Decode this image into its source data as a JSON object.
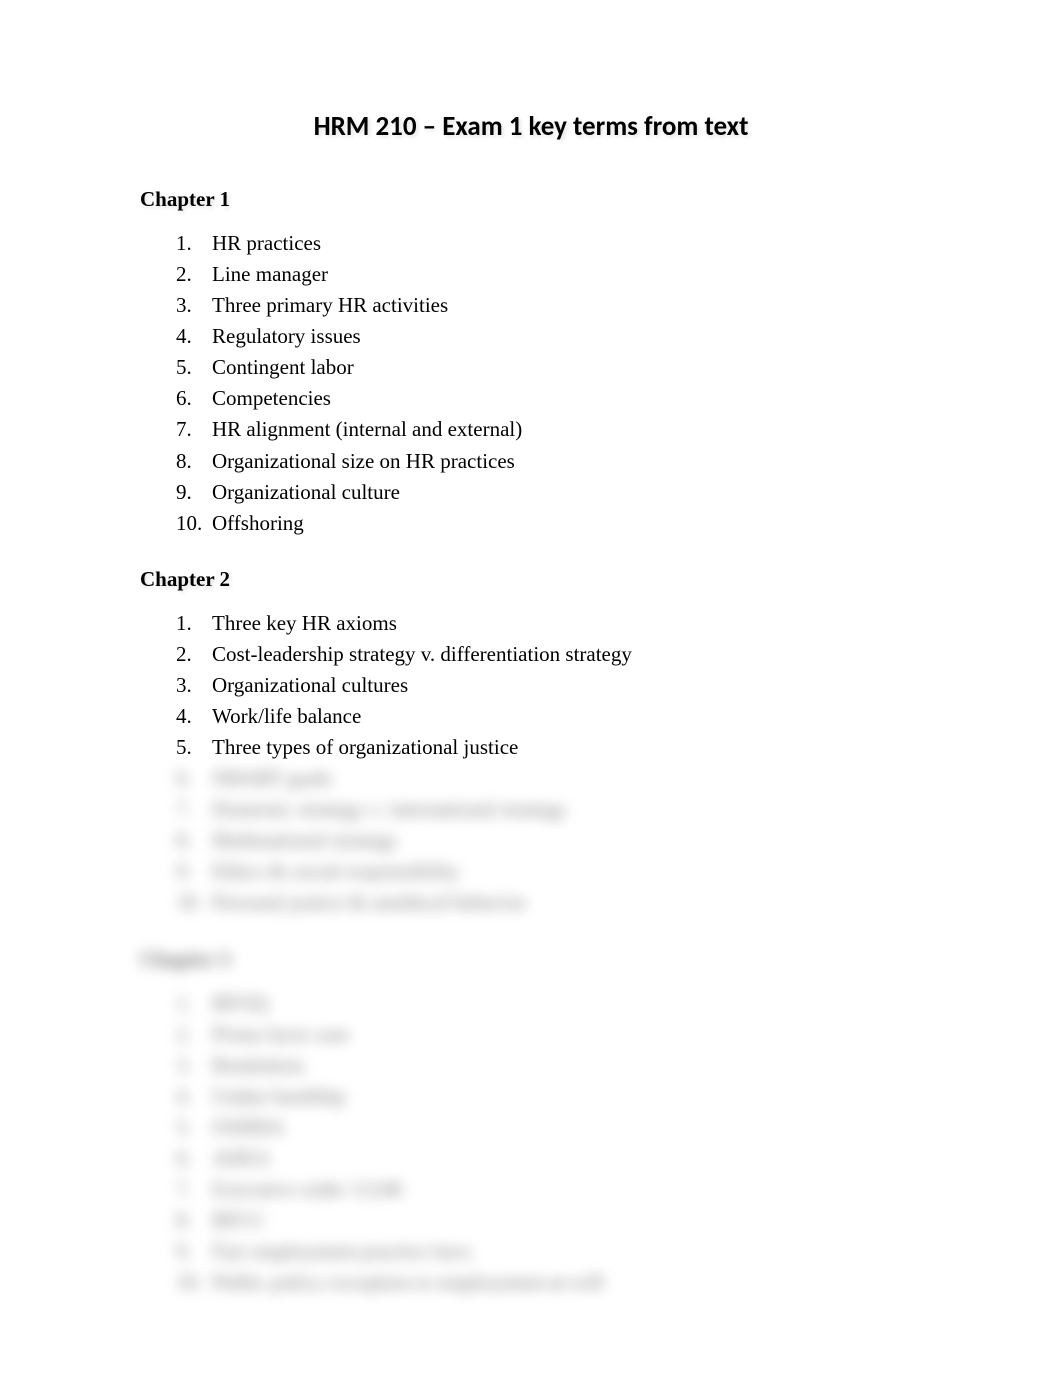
{
  "title": "HRM 210 – Exam 1 key terms from text",
  "chapters": [
    {
      "heading": "Chapter 1",
      "items": [
        "HR practices",
        "Line manager",
        "Three primary HR activities",
        "Regulatory issues",
        "Contingent labor",
        "Competencies",
        "HR alignment (internal and external)",
        "Organizational size on HR practices",
        "Organizational culture",
        "Offshoring"
      ]
    },
    {
      "heading": "Chapter 2",
      "items_visible": [
        "Three key HR axioms",
        "Cost-leadership strategy v. differentiation strategy",
        "Organizational cultures",
        "Work/life balance",
        "Three types of organizational justice"
      ],
      "items_blurred": [
        "SMART goals",
        "Domestic strategy v. international strategy",
        "Multinational strategy",
        "Ethics & social responsibility",
        "Personal justice & unethical behavior"
      ]
    },
    {
      "heading": "Chapter 3",
      "heading_blurred": true,
      "items_blurred": [
        "BFOQ",
        "Prima facie case",
        "Retaliation",
        "Undue hardship",
        "OSHHA",
        "ADEA",
        "Executive order 11246",
        "BFCC",
        "Fair employment practice laws",
        "Public policy exception to employment-at-will"
      ]
    }
  ]
}
